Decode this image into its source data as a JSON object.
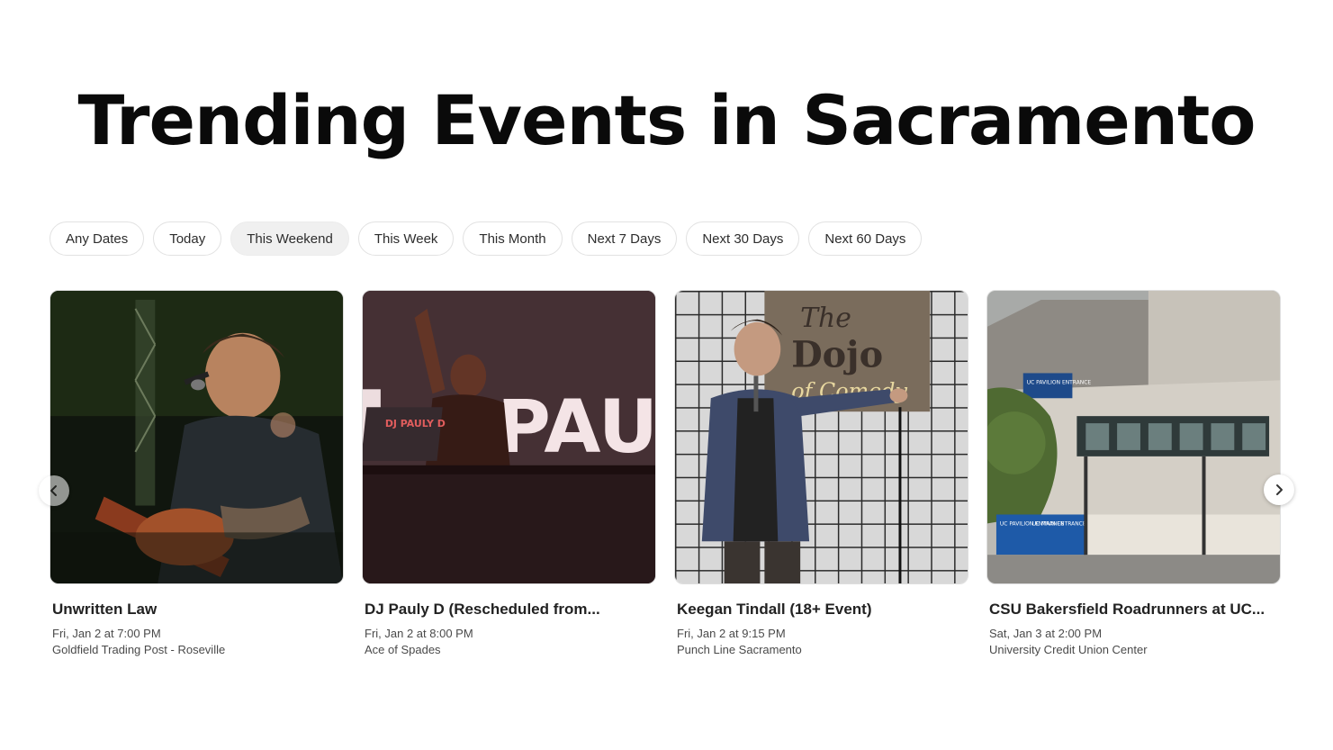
{
  "page": {
    "title": "Trending Events in Sacramento"
  },
  "filters": [
    {
      "label": "Any Dates",
      "active": false
    },
    {
      "label": "Today",
      "active": false
    },
    {
      "label": "This Weekend",
      "active": true
    },
    {
      "label": "This Week",
      "active": false
    },
    {
      "label": "This Month",
      "active": false
    },
    {
      "label": "Next 7 Days",
      "active": false
    },
    {
      "label": "Next 30 Days",
      "active": false
    },
    {
      "label": "Next 60 Days",
      "active": false
    }
  ],
  "events": [
    {
      "title": "Unwritten Law",
      "date": "Fri, Jan 2 at 7:00 PM",
      "venue": "Goldfield Trading Post - Roseville"
    },
    {
      "title": "DJ Pauly D (Rescheduled from...",
      "date": "Fri, Jan 2 at 8:00 PM",
      "venue": "Ace of Spades"
    },
    {
      "title": "Keegan Tindall (18+ Event)",
      "date": "Fri, Jan 2 at 9:15 PM",
      "venue": "Punch Line Sacramento"
    },
    {
      "title": "CSU Bakersfield Roadrunners at UC...",
      "date": "Sat, Jan 3 at 2:00 PM",
      "venue": "University Credit Union Center"
    }
  ],
  "image_text": {
    "dj_sign": "PAUL",
    "dj_laptop": "DJ PAULY D",
    "dojo_line1": "The",
    "dojo_line2": "Dojo",
    "dojo_line3": "of Comedy",
    "arena_sign": "UC PAVILION ENTRANCE",
    "arena_banner1": "UC PAVILION ENTRANCE",
    "arena_banner2": "UC MAIN ENTRANCE"
  },
  "icons": {
    "prev": "chevron-left-icon",
    "next": "chevron-right-icon"
  }
}
